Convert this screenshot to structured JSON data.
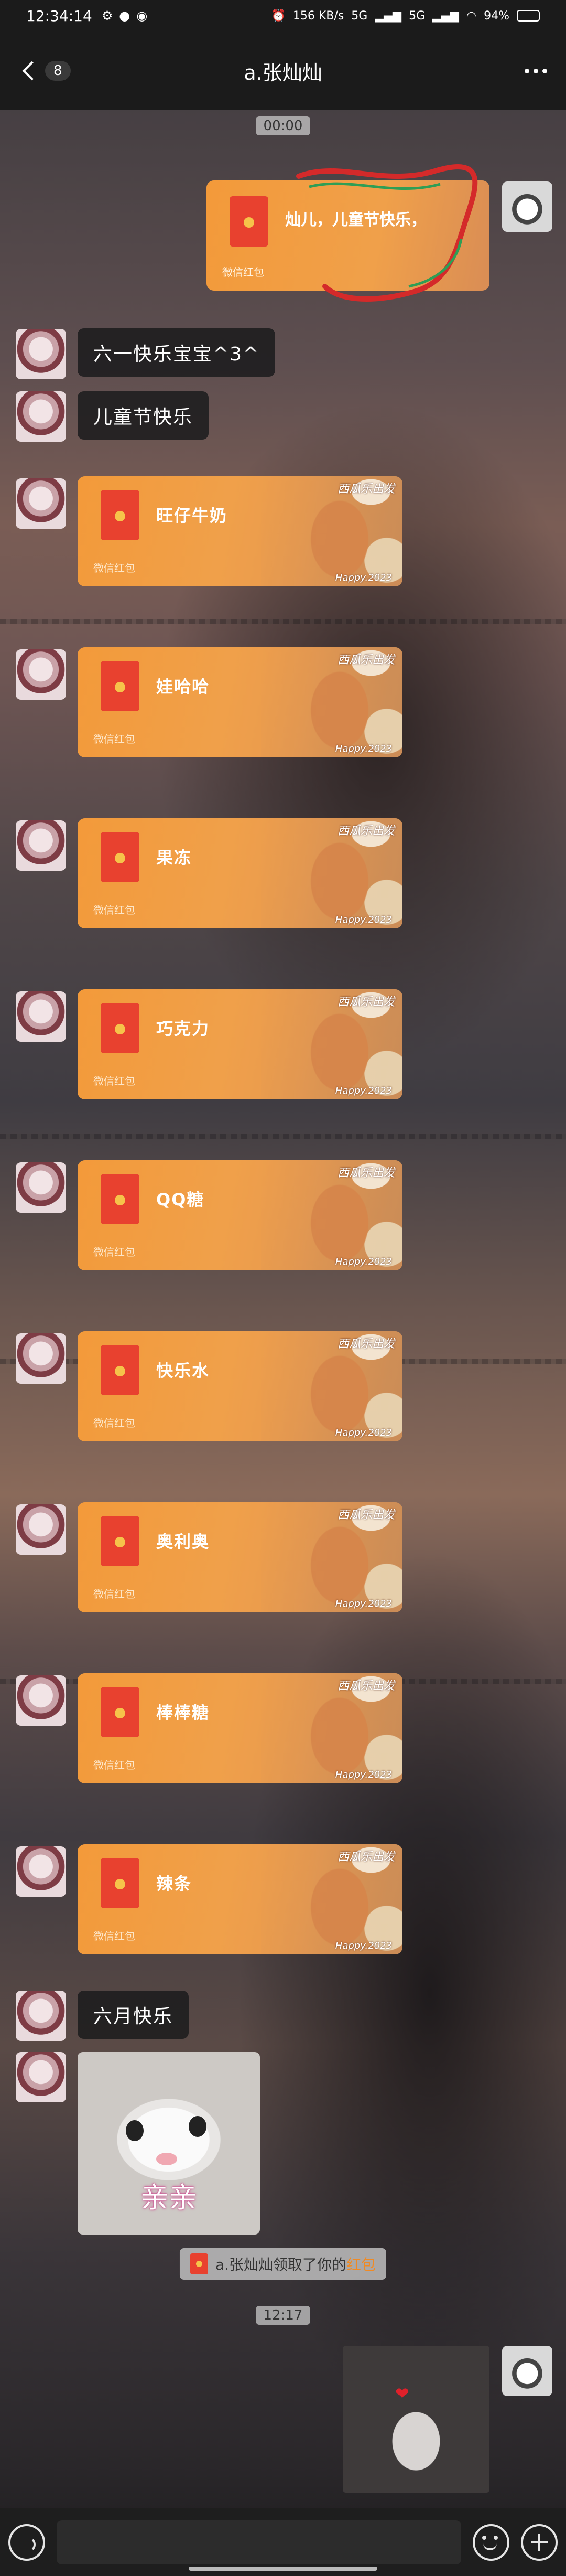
{
  "status_bar": {
    "time": "12:34:14",
    "network_speed": "156 KB/s",
    "signal_1": "5G",
    "signal_2": "5G",
    "battery": "94%",
    "battery_level": 0.94
  },
  "header": {
    "unread_count": "8",
    "title": "a.张灿灿"
  },
  "timestamps": {
    "first": "00:00",
    "second": "12:17"
  },
  "sent_red_packet": {
    "label": "灿儿，儿童节快乐，",
    "footer": "微信红包"
  },
  "messages": [
    {
      "type": "text",
      "text": "六一快乐宝宝^3^"
    },
    {
      "type": "text",
      "text": "儿童节快乐"
    }
  ],
  "red_packets": {
    "footer": "微信红包",
    "deco_label": "西瓜乐出发",
    "happy_text": "Happy.2023",
    "items": [
      {
        "label": "旺仔牛奶"
      },
      {
        "label": "娃哈哈"
      },
      {
        "label": "果冻"
      },
      {
        "label": "巧克力"
      },
      {
        "label": "QQ糖"
      },
      {
        "label": "快乐水"
      },
      {
        "label": "奥利奥"
      },
      {
        "label": "棒棒糖"
      },
      {
        "label": "辣条"
      }
    ]
  },
  "last_text": {
    "text": "六月快乐"
  },
  "sticker": {
    "caption": "亲亲"
  },
  "system_message": {
    "prefix": "a.张灿灿领取了你的",
    "highlight": "红包"
  },
  "input_bar": {
    "placeholder": ""
  },
  "icons": {
    "back": "chevron-left-icon",
    "more": "more-dots-icon",
    "voice": "voice-icon",
    "emoji": "emoji-icon",
    "plus": "plus-icon"
  }
}
